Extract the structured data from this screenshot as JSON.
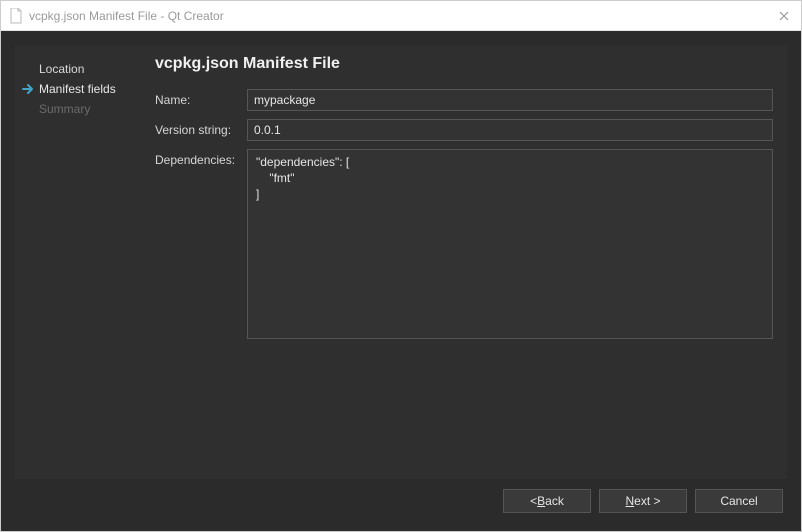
{
  "window": {
    "title": "vcpkg.json Manifest File - Qt Creator"
  },
  "sidebar": {
    "items": [
      {
        "label": "Location",
        "state": "done"
      },
      {
        "label": "Manifest fields",
        "state": "current"
      },
      {
        "label": "Summary",
        "state": "future"
      }
    ]
  },
  "main": {
    "heading": "vcpkg.json Manifest File",
    "name_label": "Name:",
    "name_value": "mypackage",
    "version_label": "Version string:",
    "version_value": "0.0.1",
    "deps_label": "Dependencies:",
    "deps_value": "\"dependencies\": [\n    \"fmt\"\n]"
  },
  "buttons": {
    "back_prefix": "< ",
    "back_u": "B",
    "back_rest": "ack",
    "next_u": "N",
    "next_rest": "ext >",
    "cancel": "Cancel"
  }
}
